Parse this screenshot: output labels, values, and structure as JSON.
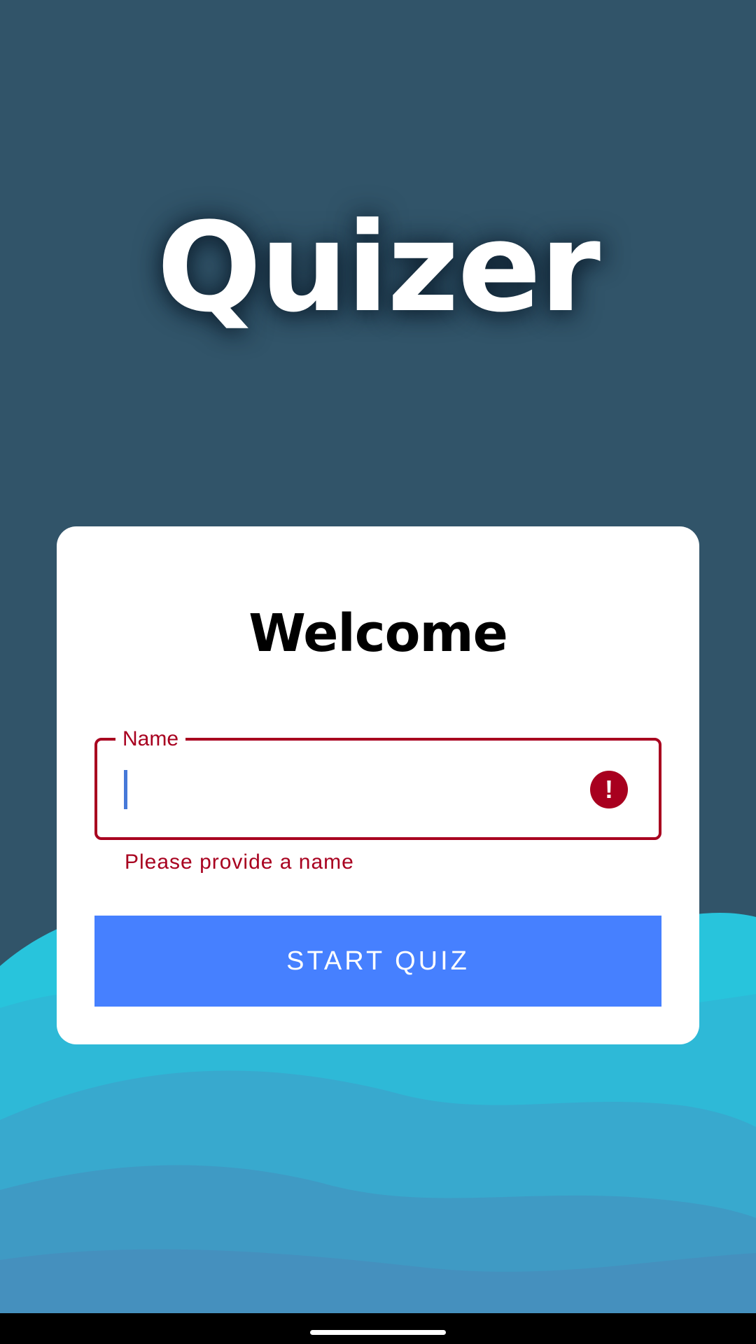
{
  "app": {
    "title": "Quizer"
  },
  "card": {
    "heading": "Welcome",
    "name_field": {
      "label": "Name",
      "value": "",
      "error_icon_glyph": "!",
      "error_message": "Please provide a name"
    },
    "start_button_label": "START QUIZ"
  },
  "colors": {
    "background": "#315469",
    "wave_cyan": "#28c4dc",
    "error": "#a8001f",
    "accent_button": "#4680ff",
    "card": "#ffffff"
  },
  "icons": {
    "error": "error-circle-icon",
    "nav_handle": "gesture-handle"
  }
}
